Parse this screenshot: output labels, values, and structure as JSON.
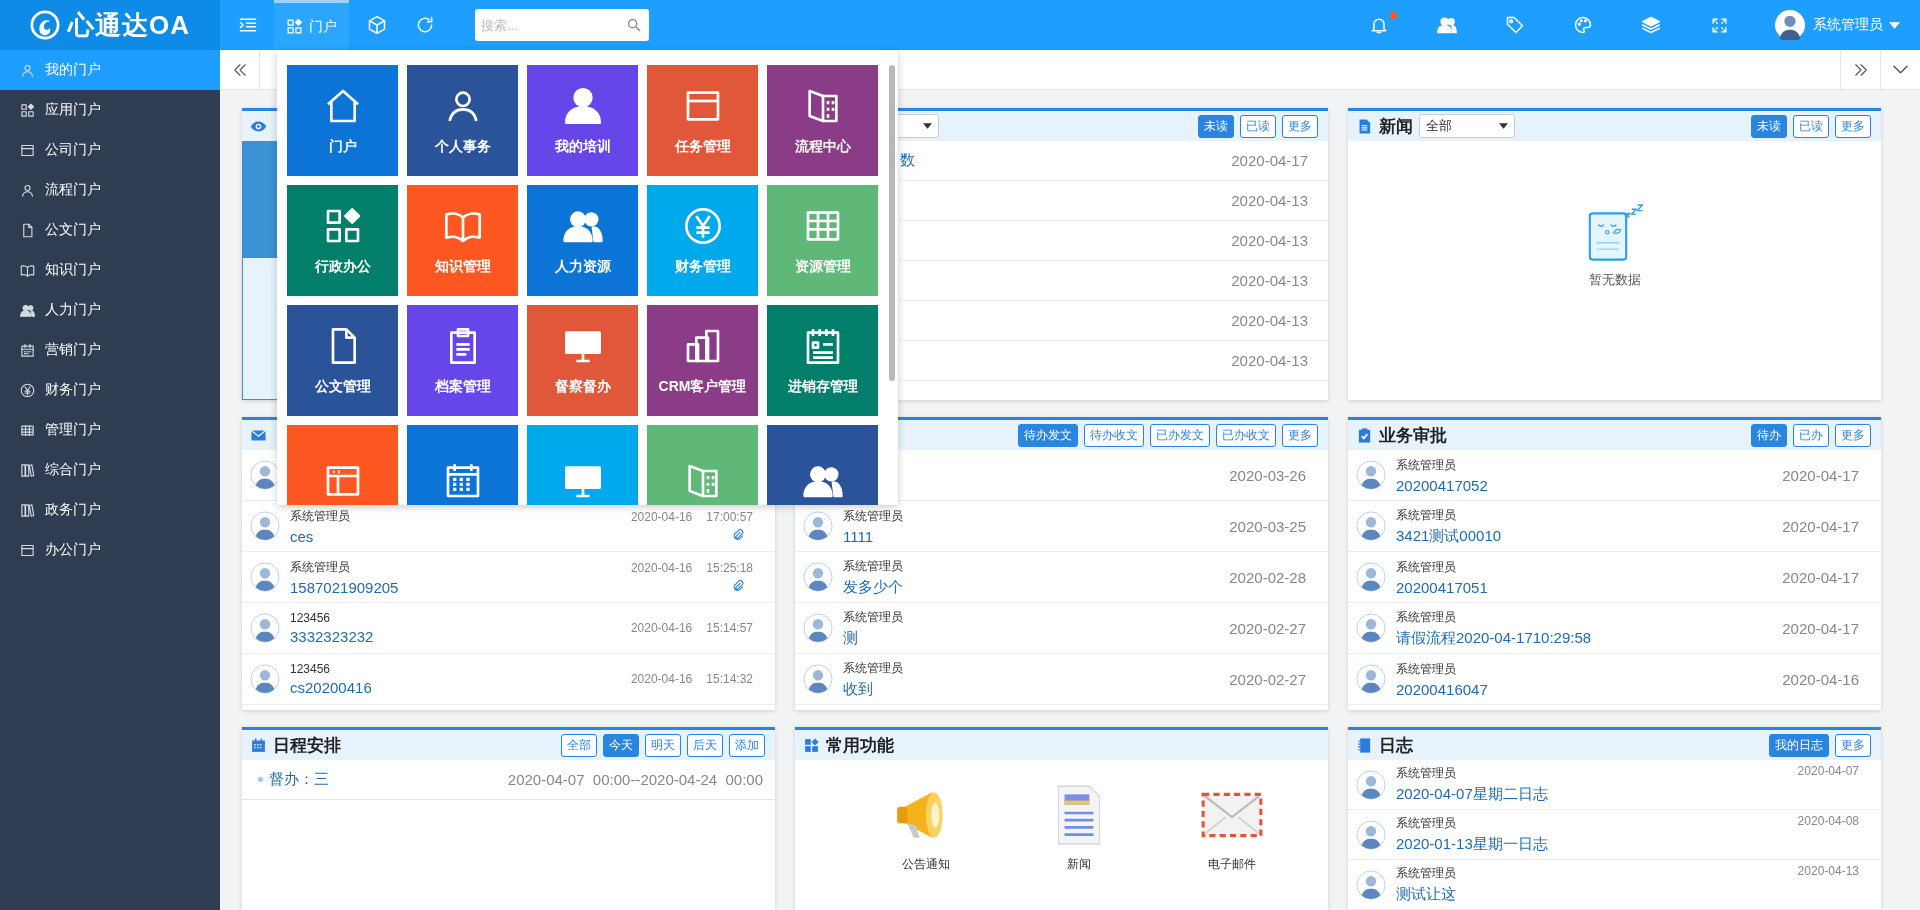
{
  "topbar": {
    "logo": "心通达OA",
    "tabs": [
      {
        "label": "门户",
        "selected": true
      }
    ],
    "search": {
      "placeholder": "搜索..."
    },
    "bell": {
      "unread": true
    },
    "user": {
      "name": "系统管理员"
    }
  },
  "sidebar": {
    "items": [
      {
        "label": "我的门户",
        "selected": true
      },
      {
        "label": "应用门户",
        "selected": false
      },
      {
        "label": "公司门户",
        "selected": false
      },
      {
        "label": "流程门户",
        "selected": false
      },
      {
        "label": "公文门户",
        "selected": false
      },
      {
        "label": "知识门户",
        "selected": false
      },
      {
        "label": "人力门户",
        "selected": false
      },
      {
        "label": "营销门户",
        "selected": false
      },
      {
        "label": "财务门户",
        "selected": false
      },
      {
        "label": "管理门户",
        "selected": false
      },
      {
        "label": "综合门户",
        "selected": false
      },
      {
        "label": "政务门户",
        "selected": false
      },
      {
        "label": "办公门户",
        "selected": false
      }
    ]
  },
  "portal_menu": {
    "tiles": [
      {
        "label": "门户",
        "color": "#0b74d6"
      },
      {
        "label": "个人事务",
        "color": "#2b539a"
      },
      {
        "label": "我的培训",
        "color": "#6645e9"
      },
      {
        "label": "任务管理",
        "color": "#e0573a"
      },
      {
        "label": "流程中心",
        "color": "#8b3c86"
      },
      {
        "label": "行政办公",
        "color": "#017f6b"
      },
      {
        "label": "知识管理",
        "color": "#fe5722"
      },
      {
        "label": "人力资源",
        "color": "#0b74d6"
      },
      {
        "label": "财务管理",
        "color": "#00a9eb"
      },
      {
        "label": "资源管理",
        "color": "#5fb877"
      },
      {
        "label": "公文管理",
        "color": "#2b539a"
      },
      {
        "label": "档案管理",
        "color": "#6645e9"
      },
      {
        "label": "督察督办",
        "color": "#e0573a"
      },
      {
        "label": "CRM客户管理",
        "color": "#8b3c86"
      },
      {
        "label": "进销存管理",
        "color": "#017f6b"
      },
      {
        "color": "#fe5722"
      },
      {
        "color": "#0b74d6"
      },
      {
        "color": "#00a9eb"
      },
      {
        "color": "#5fb877"
      },
      {
        "color": "#2b539a"
      }
    ]
  },
  "panels": [
    {
      "kind": "slides"
    },
    {
      "kind": "dated_list",
      "select": {
        "expanded": false
      },
      "buttons": [
        {
          "label": "未读",
          "selected": true
        },
        {
          "label": "已读",
          "selected": false
        },
        {
          "label": "更多",
          "selected": false
        }
      ],
      "rows": [
        {
          "title": "数",
          "date": "2020-04-17"
        },
        {
          "date": "2020-04-13"
        },
        {
          "date": "2020-04-13"
        },
        {
          "date": "2020-04-13"
        },
        {
          "date": "2020-04-13"
        },
        {
          "date": "2020-04-13"
        }
      ]
    },
    {
      "kind": "empty",
      "title": "新闻",
      "select": {
        "value": "全部",
        "expanded": false
      },
      "buttons": [
        {
          "label": "未读",
          "selected": true
        },
        {
          "label": "已读",
          "selected": false
        },
        {
          "label": "更多",
          "selected": false
        }
      ],
      "message": "暂无数据"
    },
    {
      "kind": "mail_list",
      "rows": [
        {},
        {
          "name": "系统管理员",
          "title": "ces",
          "date": "2020-04-16",
          "time": "17:00:57",
          "attachment": true
        },
        {
          "name": "系统管理员",
          "title": "1587021909205",
          "date": "2020-04-16",
          "time": "15:25:18",
          "attachment": true
        },
        {
          "name": "123456",
          "title": "3332323232",
          "date": "2020-04-16",
          "time": "15:14:57",
          "attachment": false
        },
        {
          "name": "123456",
          "title": "cs20200416",
          "date": "2020-04-16",
          "time": "15:14:32",
          "attachment": false
        }
      ]
    },
    {
      "kind": "person_list",
      "buttons": [
        {
          "label": "待办发文",
          "selected": true
        },
        {
          "label": "待办收文",
          "selected": false
        },
        {
          "label": "已办发文",
          "selected": false
        },
        {
          "label": "已办收文",
          "selected": false
        },
        {
          "label": "更多",
          "selected": false
        }
      ],
      "rows": [
        {
          "date": "2020-03-26"
        },
        {
          "name": "系统管理员",
          "title": "1111",
          "date": "2020-03-25"
        },
        {
          "name": "系统管理员",
          "title": "发多少个",
          "date": "2020-02-28"
        },
        {
          "name": "系统管理员",
          "title": "测",
          "date": "2020-02-27"
        },
        {
          "name": "系统管理员",
          "title": "收到",
          "date": "2020-02-27"
        }
      ]
    },
    {
      "kind": "person_list",
      "title": "业务审批",
      "buttons": [
        {
          "label": "待办",
          "selected": true
        },
        {
          "label": "已办",
          "selected": false
        },
        {
          "label": "更多",
          "selected": false
        }
      ],
      "rows": [
        {
          "name": "系统管理员",
          "title": "20200417052",
          "date": "2020-04-17"
        },
        {
          "name": "系统管理员",
          "title": "3421测试00010",
          "date": "2020-04-17"
        },
        {
          "name": "系统管理员",
          "title": "20200417051",
          "date": "2020-04-17"
        },
        {
          "name": "系统管理员",
          "title": "请假流程2020-04-1710:29:58",
          "date": "2020-04-17"
        },
        {
          "name": "系统管理员",
          "title": "20200416047",
          "date": "2020-04-16"
        }
      ]
    },
    {
      "kind": "schedule",
      "title": "日程安排",
      "buttons": [
        {
          "label": "全部",
          "selected": false
        },
        {
          "label": "今天",
          "selected": true
        },
        {
          "label": "明天",
          "selected": false
        },
        {
          "label": "后天",
          "selected": false
        },
        {
          "label": "添加",
          "selected": false
        }
      ],
      "rows": [
        {
          "title": "督办：三",
          "period": "2020-04-07  00:00--2020-04-24  00:00"
        }
      ]
    },
    {
      "kind": "shortcuts",
      "title": "常用功能",
      "items": [
        {
          "label": "公告通知"
        },
        {
          "label": "新闻"
        },
        {
          "label": "电子邮件"
        }
      ]
    },
    {
      "kind": "log_list",
      "title": "日志",
      "buttons": [
        {
          "label": "我的日志",
          "selected": true
        },
        {
          "label": "更多",
          "selected": false
        }
      ],
      "rows": [
        {
          "name": "系统管理员",
          "title": "2020-04-07星期二日志",
          "date": "2020-04-07"
        },
        {
          "name": "系统管理员",
          "title": "2020-01-13星期一日志",
          "date": "2020-04-08"
        },
        {
          "name": "系统管理员",
          "title": "测试让这",
          "date": "2020-04-13"
        }
      ]
    }
  ]
}
